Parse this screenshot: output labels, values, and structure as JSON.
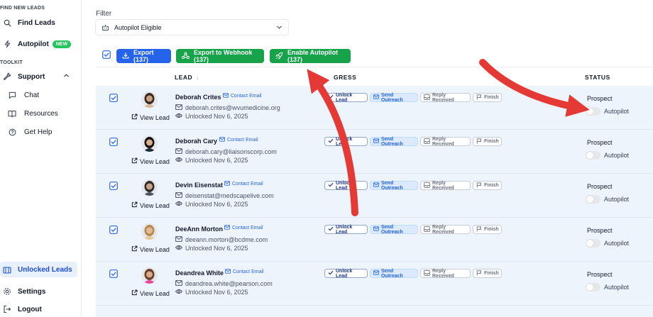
{
  "sidebar": {
    "section_find": "FIND NEW LEADS",
    "find_leads": "Find Leads",
    "autopilot": "Autopilot",
    "autopilot_badge": "NEW",
    "section_toolkit": "TOOLKIT",
    "support": "Support",
    "chat": "Chat",
    "resources": "Resources",
    "get_help": "Get Help",
    "unlocked_leads": "Unlocked Leads",
    "settings": "Settings",
    "logout": "Logout"
  },
  "filter": {
    "label": "Filter",
    "value": "Autopilot Eligible"
  },
  "toolbar": {
    "export": "Export (137)",
    "webhook": "Export to Webhook (137)",
    "autopilot": "Enable Autopilot (137)"
  },
  "table": {
    "col_lead": "LEAD",
    "col_progress": "GRESS",
    "col_status": "STATUS"
  },
  "labels": {
    "view_lead": "View Lead",
    "contact_email": "Contact Email",
    "unlock_lead": "Unlock Lead",
    "send_outreach": "Send Outreach",
    "reply_received": "Reply Received",
    "finish": "Finish",
    "autopilot": "Autopilot"
  },
  "rows": [
    {
      "name": "Deborah Crites",
      "email": "deborah.crites@wvumedicine.org",
      "unlocked": "Unlocked Nov 6, 2025",
      "status": "Prospect",
      "autopilot_on": false
    },
    {
      "name": "Deborah Cary",
      "email": "deborah.cary@liaisonscorp.com",
      "unlocked": "Unlocked Nov 6, 2025",
      "status": "Prospect",
      "autopilot_on": false
    },
    {
      "name": "Devin Eisenstat",
      "email": "deisenstat@medscapelive.com",
      "unlocked": "Unlocked Nov 6, 2025",
      "status": "Prospect",
      "autopilot_on": false
    },
    {
      "name": "DeeAnn Morton",
      "email": "deeann.morton@bcdme.com",
      "unlocked": "Unlocked Nov 6, 2025",
      "status": "Prospect",
      "autopilot_on": false
    },
    {
      "name": "Deandrea White",
      "email": "deandrea.white@pearson.com",
      "unlocked": "Unlocked Nov 6, 2025",
      "status": "Prospect",
      "autopilot_on": false
    }
  ],
  "colors": {
    "primary_blue": "#2563eb",
    "green": "#16a34a",
    "row_bg": "#eef4fc",
    "annotation_red": "#e53935"
  }
}
